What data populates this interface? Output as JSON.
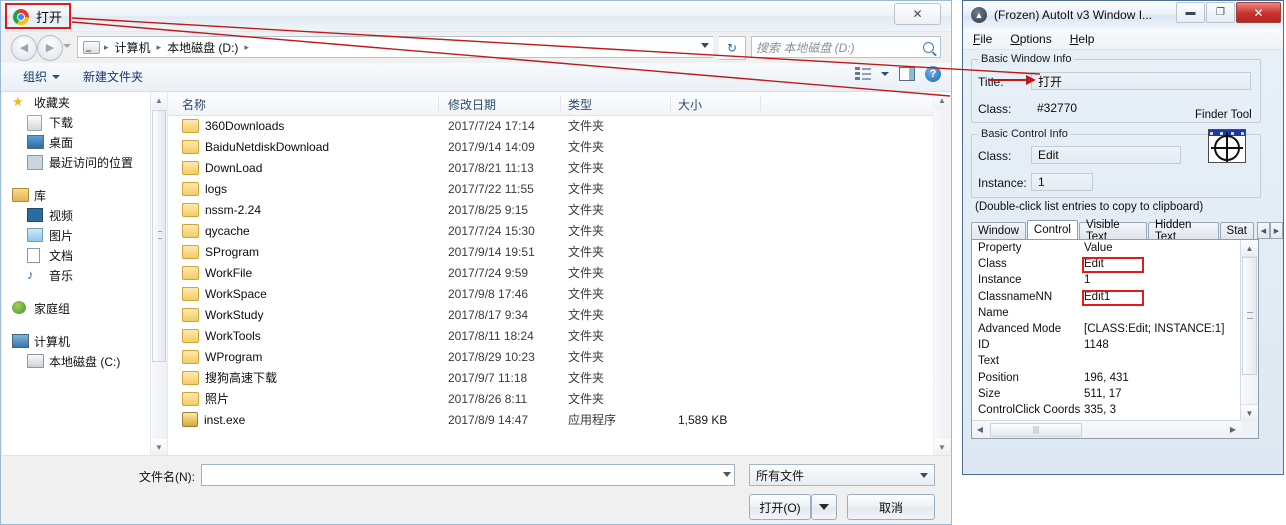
{
  "file_dialog": {
    "title": "打开",
    "title_icon": "chrome-icon",
    "close_label": "✕",
    "nav": {
      "back": "◀",
      "forward": "▶",
      "breadcrumb": [
        "计算机",
        "本地磁盘 (D:)"
      ],
      "separator": "▸",
      "refresh": "↻",
      "search_placeholder": "搜索 本地磁盘 (D:)"
    },
    "toolbar": {
      "organize": "组织",
      "new_folder": "新建文件夹",
      "help": "?"
    },
    "sidebar": [
      {
        "label": "收藏夹",
        "icon": "star-icon",
        "level": 0
      },
      {
        "label": "下载",
        "icon": "download-icon",
        "level": 1
      },
      {
        "label": "桌面",
        "icon": "desktop-icon",
        "level": 1
      },
      {
        "label": "最近访问的位置",
        "icon": "recent-icon",
        "level": 1
      },
      {
        "label": "库",
        "icon": "library-icon",
        "level": 0
      },
      {
        "label": "视频",
        "icon": "video-icon",
        "level": 1
      },
      {
        "label": "图片",
        "icon": "pictures-icon",
        "level": 1
      },
      {
        "label": "文档",
        "icon": "documents-icon",
        "level": 1
      },
      {
        "label": "音乐",
        "icon": "music-icon",
        "level": 1
      },
      {
        "label": "家庭组",
        "icon": "homegroup-icon",
        "level": 0
      },
      {
        "label": "计算机",
        "icon": "computer-icon",
        "level": 0
      },
      {
        "label": "本地磁盘 (C:)",
        "icon": "drive-icon",
        "level": 1
      }
    ],
    "columns": [
      "名称",
      "修改日期",
      "类型",
      "大小"
    ],
    "files": [
      {
        "name": "360Downloads",
        "date": "2017/7/24 17:14",
        "type": "文件夹",
        "size": "",
        "icon": "folder-icon"
      },
      {
        "name": "BaiduNetdiskDownload",
        "date": "2017/9/14 14:09",
        "type": "文件夹",
        "size": "",
        "icon": "folder-icon"
      },
      {
        "name": "DownLoad",
        "date": "2017/8/21 11:13",
        "type": "文件夹",
        "size": "",
        "icon": "folder-icon"
      },
      {
        "name": "logs",
        "date": "2017/7/22 11:55",
        "type": "文件夹",
        "size": "",
        "icon": "folder-icon"
      },
      {
        "name": "nssm-2.24",
        "date": "2017/8/25 9:15",
        "type": "文件夹",
        "size": "",
        "icon": "folder-icon"
      },
      {
        "name": "qycache",
        "date": "2017/7/24 15:30",
        "type": "文件夹",
        "size": "",
        "icon": "folder-icon"
      },
      {
        "name": "SProgram",
        "date": "2017/9/14 19:51",
        "type": "文件夹",
        "size": "",
        "icon": "folder-icon"
      },
      {
        "name": "WorkFile",
        "date": "2017/7/24 9:59",
        "type": "文件夹",
        "size": "",
        "icon": "folder-icon"
      },
      {
        "name": "WorkSpace",
        "date": "2017/9/8 17:46",
        "type": "文件夹",
        "size": "",
        "icon": "folder-icon"
      },
      {
        "name": "WorkStudy",
        "date": "2017/8/17 9:34",
        "type": "文件夹",
        "size": "",
        "icon": "folder-icon"
      },
      {
        "name": "WorkTools",
        "date": "2017/8/11 18:24",
        "type": "文件夹",
        "size": "",
        "icon": "folder-icon"
      },
      {
        "name": "WProgram",
        "date": "2017/8/29 10:23",
        "type": "文件夹",
        "size": "",
        "icon": "folder-icon"
      },
      {
        "name": "搜狗高速下载",
        "date": "2017/9/7 11:18",
        "type": "文件夹",
        "size": "",
        "icon": "folder-icon"
      },
      {
        "name": "照片",
        "date": "2017/8/26 8:11",
        "type": "文件夹",
        "size": "",
        "icon": "folder-icon"
      },
      {
        "name": "inst.exe",
        "date": "2017/8/9 14:47",
        "type": "应用程序",
        "size": "1,589 KB",
        "icon": "exe-icon"
      }
    ],
    "bottom": {
      "filename_label": "文件名(N):",
      "filename_value": "",
      "filter_value": "所有文件",
      "open_button": "打开(O)",
      "cancel_button": "取消"
    }
  },
  "autoit": {
    "title": "(Frozen) AutoIt v3 Window I...",
    "window_buttons": {
      "minimize": "▬",
      "maximize": "❐",
      "close": "✕"
    },
    "menu": [
      "File",
      "Options",
      "Help"
    ],
    "basic_window_info": {
      "legend": "Basic Window Info",
      "title_label": "Title:",
      "title_value": "打开",
      "class_label": "Class:",
      "class_value": "#32770"
    },
    "basic_control_info": {
      "legend": "Basic Control Info",
      "class_label": "Class:",
      "class_value": "Edit",
      "instance_label": "Instance:",
      "instance_value": "1"
    },
    "finder_tool": {
      "label": "Finder Tool",
      "icon": "crosshair-finder-icon"
    },
    "hint": "(Double-click list entries to copy to clipboard)",
    "tabs": [
      {
        "label": "Window",
        "active": false
      },
      {
        "label": "Control",
        "active": true
      },
      {
        "label": "Visible Text",
        "active": false
      },
      {
        "label": "Hidden Text",
        "active": false
      },
      {
        "label": "Stat",
        "active": false
      }
    ],
    "tab_arrows": {
      "left": "◀",
      "right": "▶"
    },
    "property_columns": [
      "Property",
      "Value"
    ],
    "properties": [
      {
        "property": "Class",
        "value": "Edit"
      },
      {
        "property": "Instance",
        "value": "1"
      },
      {
        "property": "ClassnameNN",
        "value": "Edit1"
      },
      {
        "property": "Name",
        "value": ""
      },
      {
        "property": "Advanced Mode",
        "value": "[CLASS:Edit; INSTANCE:1]"
      },
      {
        "property": "ID",
        "value": "1148"
      },
      {
        "property": "Text",
        "value": ""
      },
      {
        "property": "Position",
        "value": "196, 431"
      },
      {
        "property": "Size",
        "value": "511, 17"
      },
      {
        "property": "ControlClick Coords",
        "value": "335, 3"
      }
    ]
  },
  "annotation": {
    "color": "#e01b1b",
    "highlights": [
      "dialog-title",
      "autoit-title-value",
      "finder-tool",
      "property-class-value",
      "property-classnamenn-value"
    ]
  }
}
